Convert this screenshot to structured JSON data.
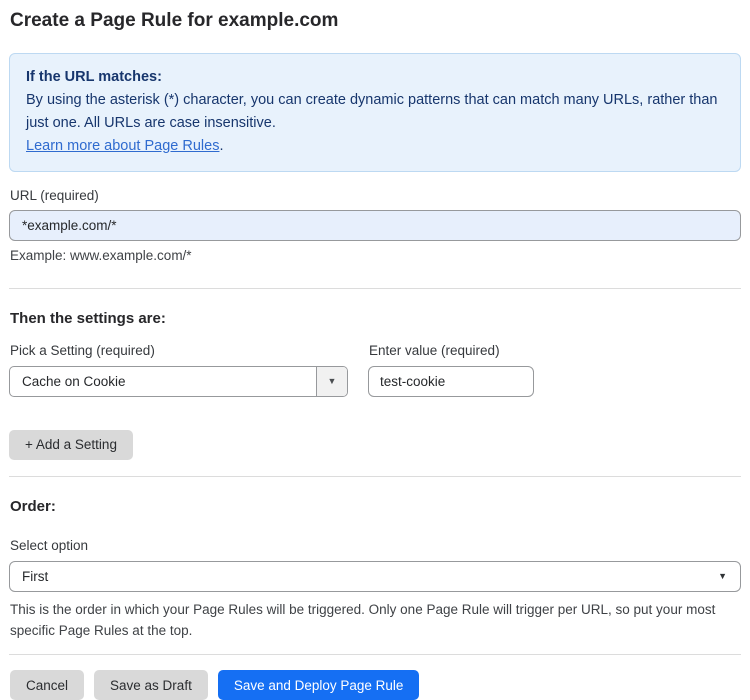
{
  "page": {
    "title": "Create a Page Rule for example.com"
  },
  "info_box": {
    "heading": "If the URL matches:",
    "body": "By using the asterisk (*) character, you can create dynamic patterns that can match many URLs, rather than just one. All URLs are case insensitive.",
    "link_label": "Learn more about Page Rules",
    "link_suffix": "."
  },
  "url_field": {
    "label": "URL (required)",
    "value": "*example.com/*",
    "example": "Example: www.example.com/*"
  },
  "settings": {
    "heading": "Then the settings are:",
    "setting_label": "Pick a Setting (required)",
    "setting_selected": "Cache on Cookie",
    "value_label": "Enter value (required)",
    "value_text": "test-cookie",
    "add_button_label": "+ Add a Setting"
  },
  "order": {
    "heading": "Order:",
    "label": "Select option",
    "selected": "First",
    "help": "This is the order in which your Page Rules will be triggered. Only one Page Rule will trigger per URL, so put your most specific Page Rules at the top."
  },
  "actions": {
    "cancel": "Cancel",
    "save_draft": "Save as Draft",
    "save_deploy": "Save and Deploy Page Rule"
  },
  "icons": {
    "dropdown_arrow": "▼"
  },
  "colors": {
    "primary_button": "#156ff3",
    "info_box_bg": "#e8f2fc",
    "info_box_border": "#bdd9f2",
    "info_text": "#17366d",
    "link": "#2f6bcf",
    "url_input_bg": "#e7effc",
    "gray_button": "#d9d9d9"
  }
}
